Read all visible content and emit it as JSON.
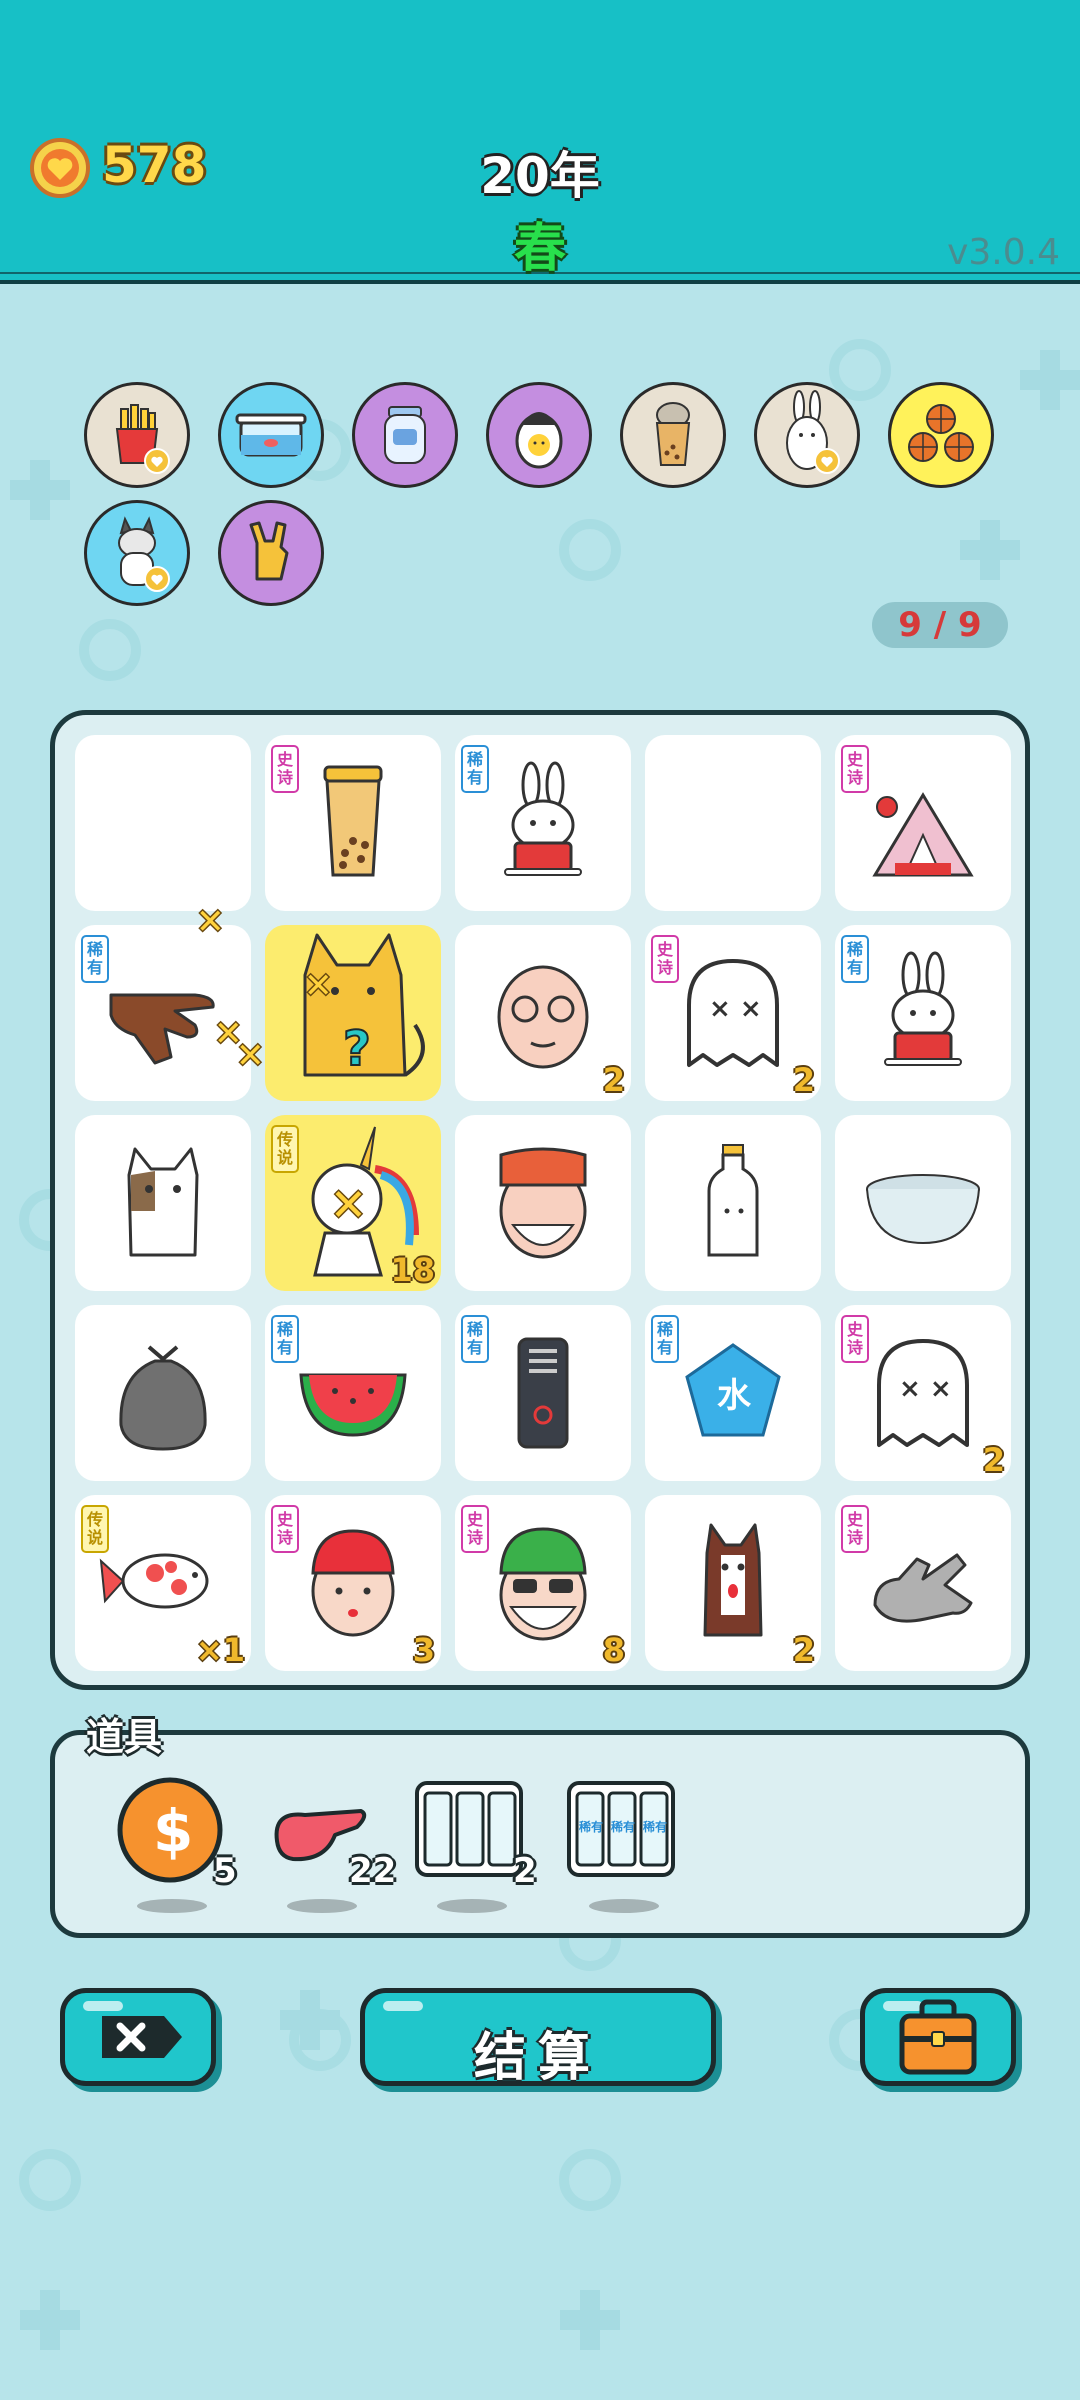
{
  "header": {
    "coins": "578",
    "year": "20年",
    "season": "春",
    "version": "v3.0.4"
  },
  "collection": {
    "items": [
      {
        "icon": "fries-icon",
        "color": "#e9e1d2"
      },
      {
        "icon": "fish-tank-icon",
        "color": "#6fd6f2"
      },
      {
        "icon": "jar-icon",
        "color": "#c48ee0"
      },
      {
        "icon": "egg-icon",
        "color": "#c48ee0"
      },
      {
        "icon": "milk-tea-icon",
        "color": "#e9e1d2"
      },
      {
        "icon": "rabbit-icon",
        "color": "#e9e1d2"
      },
      {
        "icon": "basketballs-icon",
        "color": "#fff25a"
      },
      {
        "icon": "husky-icon",
        "color": "#6fd6f2"
      },
      {
        "icon": "rock-hand-icon",
        "color": "#c48ee0"
      }
    ],
    "counter": "9 / 9"
  },
  "board": {
    "cells": [
      {
        "icon": "",
        "tag": "",
        "tag_type": "",
        "count": ""
      },
      {
        "icon": "milk-tea-icon",
        "tag": "史诗",
        "tag_type": "epic",
        "count": ""
      },
      {
        "icon": "rabbit-icon",
        "tag": "稀有",
        "tag_type": "rare",
        "count": ""
      },
      {
        "icon": "",
        "tag": "",
        "tag_type": "",
        "count": ""
      },
      {
        "icon": "rabbit-tent-icon",
        "tag": "史诗",
        "tag_type": "epic",
        "count": ""
      },
      {
        "icon": "pointing-hand-icon",
        "tag": "稀有",
        "tag_type": "rare",
        "count": ""
      },
      {
        "icon": "yellow-cat-icon",
        "tag": "",
        "tag_type": "",
        "count": "",
        "highlight": true
      },
      {
        "icon": "old-man-icon",
        "tag": "",
        "tag_type": "",
        "count": "2"
      },
      {
        "icon": "ghost-icon",
        "tag": "史诗",
        "tag_type": "epic",
        "count": "2"
      },
      {
        "icon": "rabbit-icon",
        "tag": "稀有",
        "tag_type": "rare",
        "count": ""
      },
      {
        "icon": "cat-icon",
        "tag": "",
        "tag_type": "",
        "count": ""
      },
      {
        "icon": "unicorn-icon",
        "tag": "传说",
        "tag_type": "leg",
        "count": "18",
        "highlight": true
      },
      {
        "icon": "cap-man-icon",
        "tag": "",
        "tag_type": "",
        "count": ""
      },
      {
        "icon": "milk-bottle-icon",
        "tag": "",
        "tag_type": "",
        "count": ""
      },
      {
        "icon": "bowl-icon",
        "tag": "",
        "tag_type": "",
        "count": ""
      },
      {
        "icon": "trash-bag-icon",
        "tag": "",
        "tag_type": "",
        "count": ""
      },
      {
        "icon": "watermelon-icon",
        "tag": "稀有",
        "tag_type": "rare",
        "count": ""
      },
      {
        "icon": "power-bank-icon",
        "tag": "稀有",
        "tag_type": "rare",
        "count": ""
      },
      {
        "icon": "water-gem-icon",
        "tag": "稀有",
        "tag_type": "rare",
        "count": "",
        "gem_text": "水"
      },
      {
        "icon": "ghost-icon",
        "tag": "史诗",
        "tag_type": "epic",
        "count": "2"
      },
      {
        "icon": "koi-fish-icon",
        "tag": "传说",
        "tag_type": "leg",
        "count": "×1"
      },
      {
        "icon": "red-hair-boy-icon",
        "tag": "史诗",
        "tag_type": "epic",
        "count": "3"
      },
      {
        "icon": "green-hat-man-icon",
        "tag": "史诗",
        "tag_type": "epic",
        "count": "8"
      },
      {
        "icon": "husky-icon",
        "tag": "",
        "tag_type": "",
        "count": "2"
      },
      {
        "icon": "gray-hand-icon",
        "tag": "史诗",
        "tag_type": "epic",
        "count": ""
      }
    ]
  },
  "props": {
    "title": "道具",
    "items": [
      {
        "icon": "coin-icon",
        "count": "5"
      },
      {
        "icon": "liver-icon",
        "count": "22"
      },
      {
        "icon": "remove-cards-icon",
        "count": "2"
      },
      {
        "icon": "rare-cards-icon",
        "count": "",
        "card_text": "稀有"
      }
    ]
  },
  "buttons": {
    "exit_icon": "exit-x-icon",
    "settle_label": "结算",
    "bag_icon": "briefcase-icon"
  },
  "colors": {
    "header_bg": "#17c0c6",
    "page_bg": "#b7e4ea",
    "coin_text": "#ffd84a",
    "season_text": "#28e04c",
    "counter_text": "#d63a3a",
    "epic": "#d13aa8",
    "rare": "#2a8fd6",
    "legendary": "#c8a600"
  }
}
